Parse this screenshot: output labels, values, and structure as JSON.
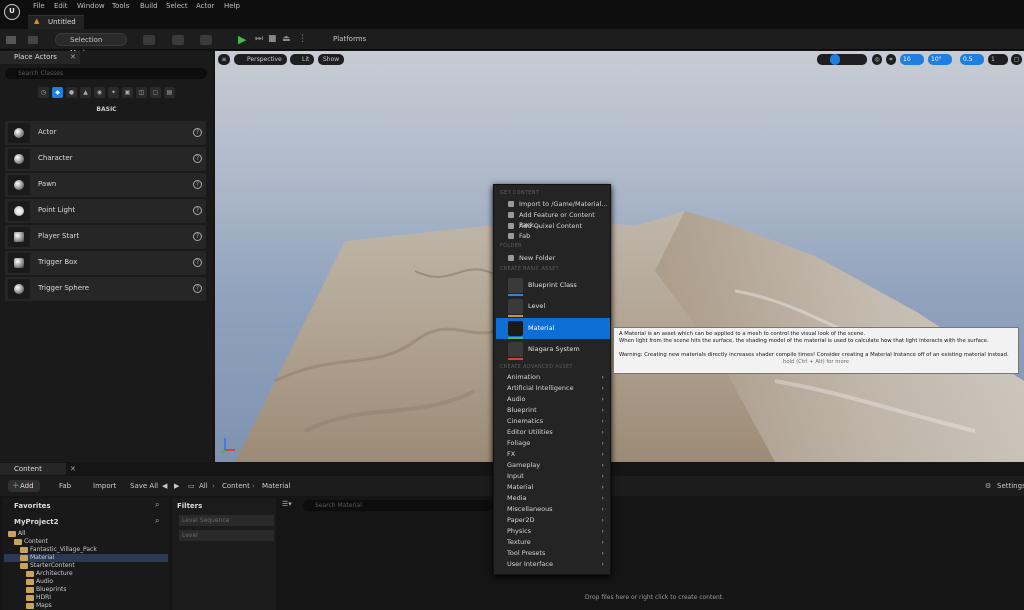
{
  "menu": [
    "File",
    "Edit",
    "Window",
    "Tools",
    "Build",
    "Select",
    "Actor",
    "Help"
  ],
  "doc_tab": "Untitled",
  "toolbar": {
    "mode": "Selection Mode",
    "platforms": "Platforms"
  },
  "place_actors": {
    "tab": "Place Actors",
    "search_placeholder": "Search Classes",
    "section": "BASIC",
    "actors": [
      "Actor",
      "Character",
      "Pawn",
      "Point Light",
      "Player Start",
      "Trigger Box",
      "Trigger Sphere"
    ]
  },
  "viewport": {
    "perspective": "Perspective",
    "lit": "Lit",
    "show": "Show",
    "grid": "10",
    "angle": "10°",
    "scale": "0.5",
    "cam": "1"
  },
  "content_browser": {
    "tab": "Content Browser",
    "add": "Add",
    "fab": "Fab",
    "import": "Import",
    "save_all": "Save All",
    "path": [
      "All",
      "Content",
      "Material"
    ],
    "settings": "Settings",
    "favorites": "Favorites",
    "project": "MyProject2",
    "filters": "Filters",
    "filter_items": [
      "Level Sequence",
      "Level"
    ],
    "search_placeholder": "Search Material",
    "drop_hint": "Drop files here or right click to create content.",
    "tree": [
      "All",
      "Content",
      "Fantastic_Village_Pack",
      "Material",
      "StarterContent",
      "Architecture",
      "Audio",
      "Blueprints",
      "HDRI",
      "Maps"
    ]
  },
  "context_menu": {
    "get_content": "GET CONTENT",
    "get_items": [
      "Import to /Game/Material...",
      "Add Feature or Content Pack...",
      "Add Quixel Content",
      "Fab"
    ],
    "folder": "FOLDER",
    "new_folder": "New Folder",
    "basic": "CREATE BASIC ASSET",
    "basic_items": [
      "Blueprint Class",
      "Level",
      "Material",
      "Niagara System"
    ],
    "advanced": "CREATE ADVANCED ASSET",
    "advanced_items": [
      "Animation",
      "Artificial Intelligence",
      "Audio",
      "Blueprint",
      "Cinematics",
      "Editor Utilities",
      "Foliage",
      "FX",
      "Gameplay",
      "Input",
      "Material",
      "Media",
      "Miscellaneous",
      "Paper2D",
      "Physics",
      "Texture",
      "Tool Presets",
      "User Interface"
    ]
  },
  "tooltip": {
    "line1": "A Material is an asset which can be applied to a mesh to control the visual look of the scene.",
    "line2": "When light from the scene hits the surface, the shading model of the material is used to calculate how that light interacts with the surface.",
    "line3": "Warning: Creating new materials directly increases shader compile times!  Consider creating a Material Instance off of an existing material instead.",
    "hint": "hold (Ctrl + Alt) for more"
  },
  "colors": {
    "accent": "#1f7fe0",
    "selected": "#0d6fd6",
    "play": "#49b84c"
  }
}
